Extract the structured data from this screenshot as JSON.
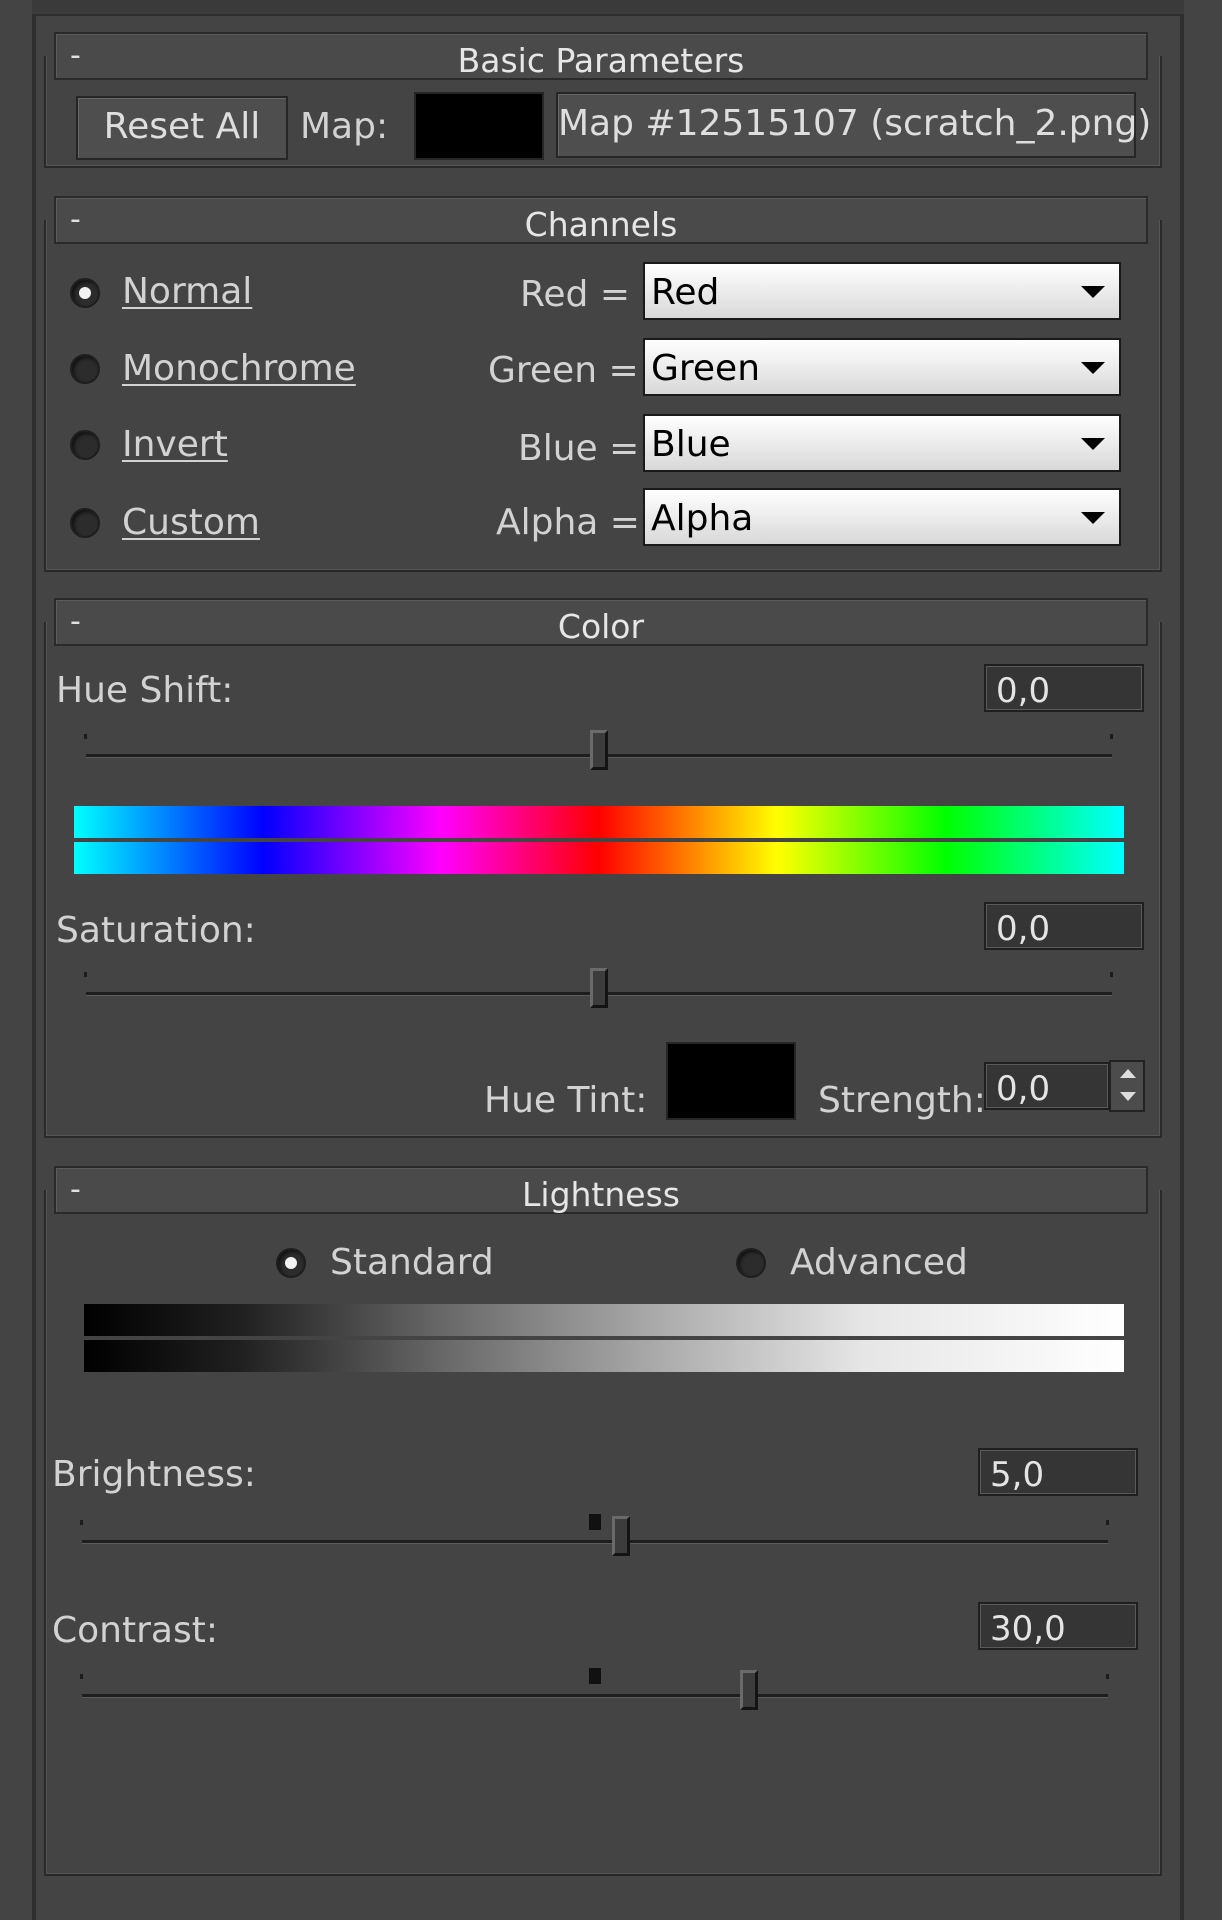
{
  "basic": {
    "title": "Basic Parameters",
    "collapse": "-",
    "reset_all": "Reset All",
    "map_label": "Map:",
    "map_name": "Map #12515107 (scratch_2.png)"
  },
  "channels": {
    "title": "Channels",
    "collapse": "-",
    "modes": [
      {
        "label": "Normal",
        "selected": true
      },
      {
        "label": "Monochrome",
        "selected": false
      },
      {
        "label": "Invert",
        "selected": false
      },
      {
        "label": "Custom",
        "selected": false
      }
    ],
    "assignments": [
      {
        "label": "Red =",
        "value": "Red"
      },
      {
        "label": "Green =",
        "value": "Green"
      },
      {
        "label": "Blue =",
        "value": "Blue"
      },
      {
        "label": "Alpha =",
        "value": "Alpha"
      }
    ]
  },
  "color": {
    "title": "Color",
    "collapse": "-",
    "hue_shift_label": "Hue Shift:",
    "hue_shift_value": "0,0",
    "hue_shift_level": 0.5,
    "saturation_label": "Saturation:",
    "saturation_value": "0,0",
    "saturation_level": 0.5,
    "hue_tint_label": "Hue Tint:",
    "strength_label": "Strength:",
    "strength_value": "0,0"
  },
  "lightness": {
    "title": "Lightness",
    "collapse": "-",
    "modes": [
      {
        "label": "Standard",
        "selected": true
      },
      {
        "label": "Advanced",
        "selected": false
      }
    ],
    "brightness_label": "Brightness:",
    "brightness_value": "5,0",
    "brightness_level": 0.525,
    "contrast_label": "Contrast:",
    "contrast_value": "30,0",
    "contrast_level": 0.65
  },
  "colors": {
    "panel_bg": "#444444",
    "swatch": "#000000"
  }
}
